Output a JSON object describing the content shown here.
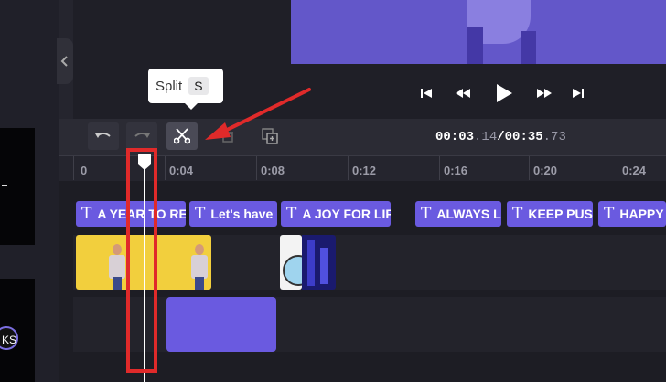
{
  "tooltip": {
    "label": "Split",
    "shortcut": "S"
  },
  "time": {
    "current_main": "00:03",
    "current_fraction": ".14",
    "separator": "/",
    "total_main": "00:35",
    "total_fraction": ".73"
  },
  "ruler": {
    "ticks": [
      "0",
      "0:04",
      "0:08",
      "0:12",
      "0:16",
      "0:20",
      "0:24"
    ]
  },
  "text_clips": [
    "A YEAR TO REI",
    "Let's have",
    "A JOY FOR LIF",
    "ALWAYS LI",
    "KEEP PUSH",
    "HAPPY"
  ],
  "left_badge": "KS",
  "icons": {
    "undo": "undo-icon",
    "redo": "redo-icon",
    "split": "scissors-icon",
    "delete": "trash-icon",
    "duplicate": "duplicate-icon",
    "skip_back": "skip-back-icon",
    "rewind": "rewind-icon",
    "play": "play-icon",
    "fast_forward": "fast-forward-icon",
    "skip_forward": "skip-forward-icon",
    "collapse": "chevron-left-icon",
    "text": "text-icon"
  },
  "colors": {
    "accent": "#6a5ae0",
    "annotation": "#e02a2a",
    "background": "#25252e"
  }
}
